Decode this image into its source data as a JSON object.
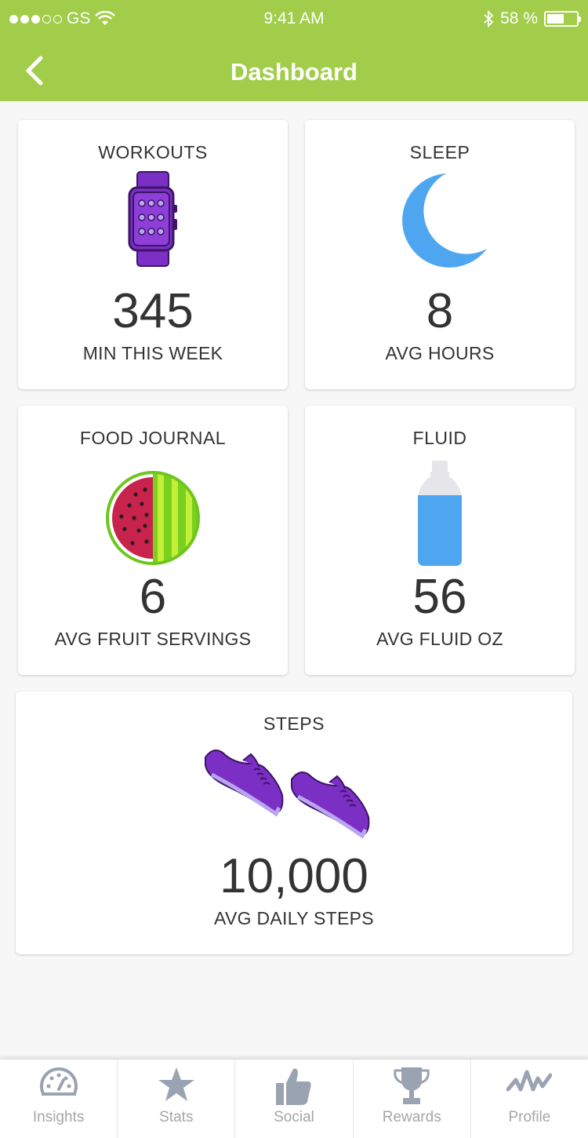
{
  "status_bar": {
    "carrier": "GS",
    "time": "9:41 AM",
    "battery": "58 %",
    "battery_level": 0.58
  },
  "header": {
    "title": "Dashboard"
  },
  "cards": {
    "workouts": {
      "label": "WORKOUTS",
      "value": "345",
      "sub": "MIN THIS WEEK",
      "icon": "smartwatch-icon"
    },
    "sleep": {
      "label": "SLEEP",
      "value": "8",
      "sub": "AVG HOURS",
      "icon": "moon-icon"
    },
    "food": {
      "label": "FOOD JOURNAL",
      "value": "6",
      "sub": "AVG FRUIT SERVINGS",
      "icon": "watermelon-icon"
    },
    "fluid": {
      "label": "FLUID",
      "value": "56",
      "sub": "AVG FLUID OZ",
      "icon": "water-bottle-icon"
    },
    "steps": {
      "label": "STEPS",
      "value": "10,000",
      "sub": "AVG DAILY STEPS",
      "icon": "sneakers-icon"
    }
  },
  "tabs": [
    {
      "label": "Insights",
      "icon": "speedometer-icon"
    },
    {
      "label": "Stats",
      "icon": "star-icon"
    },
    {
      "label": "Social",
      "icon": "thumbs-up-icon"
    },
    {
      "label": "Rewards",
      "icon": "trophy-icon"
    },
    {
      "label": "Profile",
      "icon": "activity-wave-icon"
    }
  ],
  "colors": {
    "header": "#a2cd4a",
    "purple": "#7b2fc4",
    "blue": "#4fa6f0",
    "tab_icon": "#9aa3b2"
  }
}
